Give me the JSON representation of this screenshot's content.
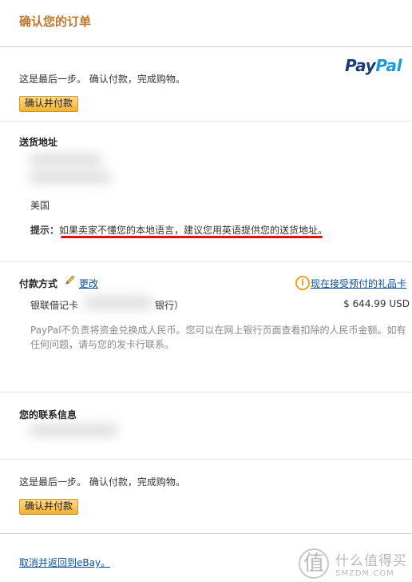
{
  "page": {
    "title": "确认您的订单",
    "brand": {
      "pay": "Pay",
      "pal": "Pal",
      "colors": {
        "pay": "#1b3a7a",
        "pal": "#1c9ad8"
      }
    },
    "last_step_text": "这是最后一步。 确认付款，完成购物。",
    "confirm_button": "确认并付款"
  },
  "shipping": {
    "heading": "送货地址",
    "country": "美国",
    "tip_label": "提示：",
    "tip_text": "如果卖家不懂您的本地语言，建议您用英语提供您的送货地址。"
  },
  "payment": {
    "heading": "付款方式",
    "edit_label": "更改",
    "gift_card_link": "现在接受预付的礼品卡",
    "card_prefix": "银联借记卡",
    "card_suffix": "银行）",
    "amount": "$ 644.99 USD",
    "disclaimer": "PayPal不负责将资金兑换成人民币。您可以在网上银行页面查看扣除的人民币金额。如有任何问题，请与您的发卡行联系。"
  },
  "contact": {
    "heading": "您的联系信息"
  },
  "bottom": {
    "last_step_text": "这是最后一步。 确认付款，完成购物。",
    "confirm_button": "确认并付款",
    "cancel_link": "取消并返回到eBay。"
  },
  "watermark": {
    "glyph": "值",
    "cn": "什么值得买",
    "en": "SMZDM.COM"
  },
  "colors": {
    "title": "#c0772b",
    "button": "#f3b131",
    "link": "#0a4f9b",
    "underline": "#e01010"
  },
  "icons": {
    "edit": "pencil-icon",
    "info": "info-icon"
  }
}
